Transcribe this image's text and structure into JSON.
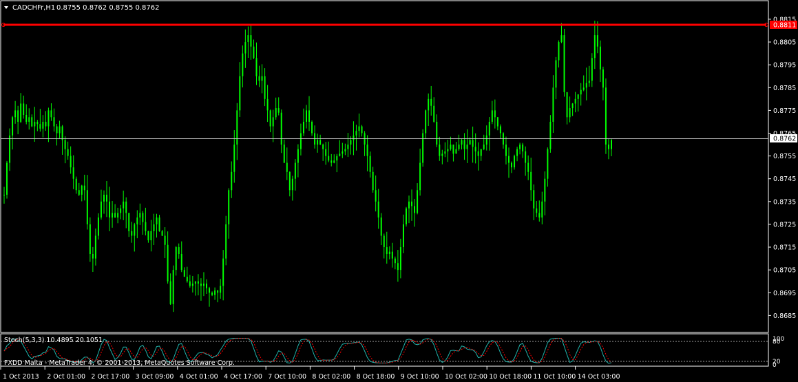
{
  "header": {
    "symbol": "CADCHFr,H1",
    "ohlc": "0.8755 0.8762 0.8755 0.8762"
  },
  "footer_note": "FXDD Malta - MetaTrader 4, © 2001-2013, MetaQuotes Software Corp.",
  "colors": {
    "background": "#000000",
    "candle": "#00ff00",
    "axis": "#ffffff",
    "alert_line": "#ff0000",
    "stoch_main": "#20b2aa",
    "stoch_signal": "#ff0000"
  },
  "price_axis": {
    "ticks": [
      "0.8815",
      "0.8805",
      "0.8795",
      "0.8785",
      "0.8775",
      "0.8765",
      "0.8755",
      "0.8745",
      "0.8735",
      "0.8725",
      "0.8715",
      "0.8705",
      "0.8695",
      "0.8685"
    ],
    "current_label": "0.8762",
    "alert_label": "0.8811"
  },
  "time_axis": {
    "labels": [
      "1 Oct 2013",
      "2 Oct 01:00",
      "2 Oct 17:00",
      "3 Oct 09:00",
      "4 Oct 01:00",
      "4 Oct 17:00",
      "7 Oct 10:00",
      "8 Oct 02:00",
      "8 Oct 18:00",
      "9 Oct 10:00",
      "10 Oct 02:00",
      "10 Oct 18:00",
      "11 Oct 10:00",
      "14 Oct 03:00"
    ]
  },
  "stoch": {
    "label": "Stoch(5,3,3) 10.4895 20.1051",
    "level_high": "80",
    "level_low": "20",
    "axis_top": "100",
    "axis_bottom": "0"
  },
  "chart_data": {
    "type": "candlestick",
    "symbol": "CADCHFr",
    "timeframe": "H1",
    "ylim": [
      0.8683,
      0.8818
    ],
    "current_price": 0.8762,
    "alert_level": 0.8811,
    "close": [
      0.8738,
      0.8752,
      0.8764,
      0.8772,
      0.8775,
      0.877,
      0.8778,
      0.8773,
      0.877,
      0.8772,
      0.8768,
      0.877,
      0.8769,
      0.8767,
      0.877,
      0.8768,
      0.8775,
      0.8772,
      0.8768,
      0.8765,
      0.8768,
      0.8762,
      0.8758,
      0.8755,
      0.875,
      0.8745,
      0.874,
      0.8738,
      0.8742,
      0.874,
      0.8725,
      0.8712,
      0.871,
      0.872,
      0.8728,
      0.8735,
      0.8738,
      0.8735,
      0.8728,
      0.873,
      0.8728,
      0.873,
      0.8732,
      0.8735,
      0.873,
      0.8722,
      0.872,
      0.8725,
      0.8728,
      0.873,
      0.8726,
      0.8722,
      0.8718,
      0.8722,
      0.8725,
      0.8728,
      0.8722,
      0.872,
      0.8716,
      0.87,
      0.869,
      0.8705,
      0.8715,
      0.8712,
      0.8705,
      0.8702,
      0.87,
      0.8698,
      0.8699,
      0.87,
      0.8699,
      0.8698,
      0.8699,
      0.8697,
      0.8695,
      0.8694,
      0.8696,
      0.8695,
      0.8698,
      0.871,
      0.8725,
      0.874,
      0.8748,
      0.876,
      0.8775,
      0.879,
      0.88,
      0.8805,
      0.8808,
      0.8803,
      0.8798,
      0.879,
      0.8788,
      0.879,
      0.878,
      0.8775,
      0.8768,
      0.8772,
      0.8776,
      0.8774,
      0.876,
      0.8752,
      0.8748,
      0.874,
      0.8745,
      0.8752,
      0.8758,
      0.8765,
      0.877,
      0.8775,
      0.877,
      0.8765,
      0.876,
      0.8762,
      0.876,
      0.8758,
      0.8755,
      0.8753,
      0.8752,
      0.8753,
      0.8755,
      0.8756,
      0.8757,
      0.8758,
      0.876,
      0.8762,
      0.8764,
      0.8766,
      0.8768,
      0.8765,
      0.876,
      0.8755,
      0.8748,
      0.874,
      0.8735,
      0.8728,
      0.872,
      0.8715,
      0.8712,
      0.8713,
      0.871,
      0.8708,
      0.8705,
      0.8715,
      0.8725,
      0.8732,
      0.8735,
      0.8733,
      0.873,
      0.874,
      0.8752,
      0.8765,
      0.8775,
      0.878,
      0.8777,
      0.877,
      0.876,
      0.8755,
      0.8756,
      0.8757,
      0.8758,
      0.876,
      0.8756,
      0.8758,
      0.876,
      0.8762,
      0.8758,
      0.876,
      0.8762,
      0.8759,
      0.8757,
      0.8755,
      0.8758,
      0.876,
      0.8764,
      0.877,
      0.8775,
      0.8772,
      0.8768,
      0.8765,
      0.876,
      0.8755,
      0.8752,
      0.875,
      0.8755,
      0.8758,
      0.876,
      0.8757,
      0.8752,
      0.8748,
      0.874,
      0.8732,
      0.873,
      0.8728,
      0.8735,
      0.8745,
      0.8758,
      0.877,
      0.8785,
      0.8797,
      0.8805,
      0.8808,
      0.8783,
      0.8772,
      0.8776,
      0.8778,
      0.878,
      0.8782,
      0.8784,
      0.8785,
      0.8787,
      0.8788,
      0.8798,
      0.8808,
      0.8803,
      0.8793,
      0.8785,
      0.876,
      0.8758,
      0.8762
    ],
    "stochastic": {
      "name": "Stoch(5,3,3)",
      "main_last": 10.4895,
      "signal_last": 20.1051,
      "levels": [
        20,
        80
      ],
      "ylim": [
        0,
        100
      ]
    }
  }
}
